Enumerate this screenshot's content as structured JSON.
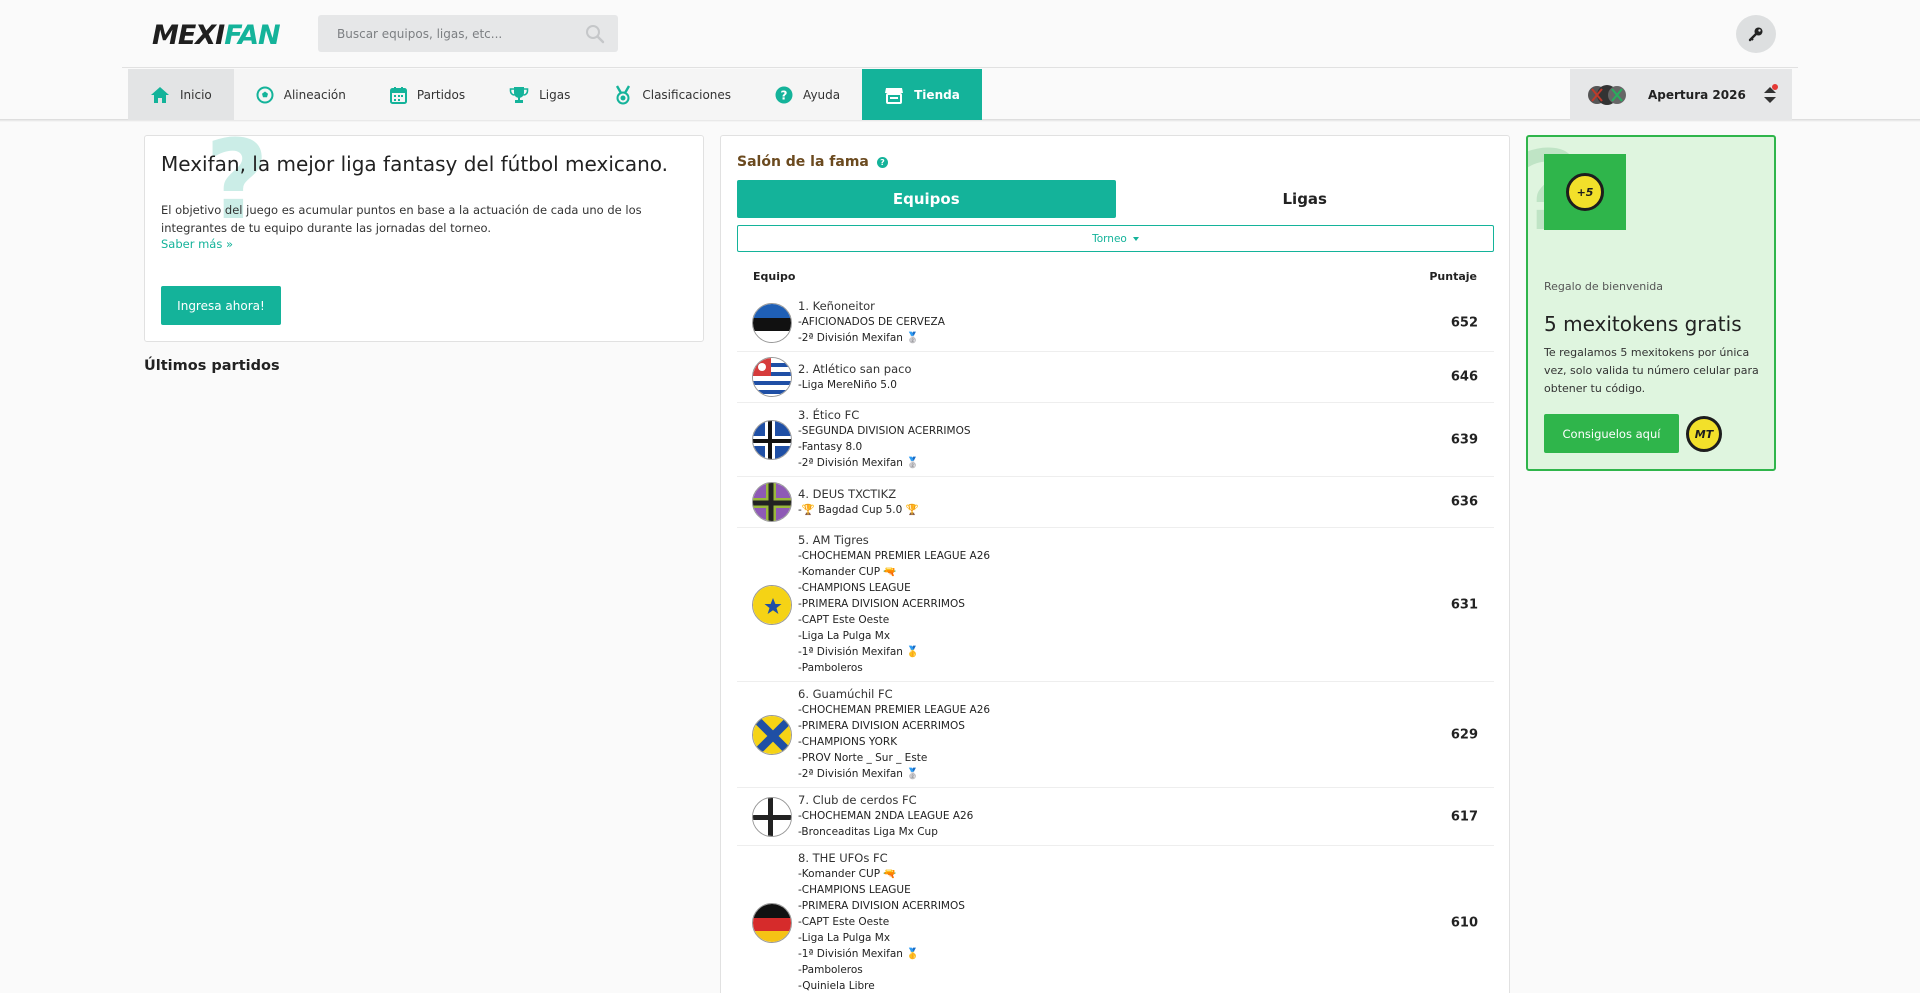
{
  "header": {
    "logo_mexi": "MEXI",
    "logo_fan": "FAN",
    "search_placeholder": "Buscar equipos, ligas, etc..."
  },
  "nav": {
    "items": [
      {
        "label": "Inicio",
        "icon": "home-icon"
      },
      {
        "label": "Alineación",
        "icon": "soccer-ball-icon"
      },
      {
        "label": "Partidos",
        "icon": "calendar-icon"
      },
      {
        "label": "Ligas",
        "icon": "trophy-icon"
      },
      {
        "label": "Clasificaciones",
        "icon": "medal-icon"
      },
      {
        "label": "Ayuda",
        "icon": "help-icon"
      },
      {
        "label": "Tienda",
        "icon": "store-icon"
      }
    ],
    "season": "Apertura 2026"
  },
  "intro": {
    "title": "Mexifan, la mejor liga fantasy del fútbol mexicano.",
    "description": "El objetivo del juego es acumular puntos en base a la actuación de cada uno de los integrantes de tu equipo durante las jornadas del torneo.",
    "more_link": "Saber más »",
    "cta": "Ingresa ahora!"
  },
  "latest_matches_title": "Últimos partidos",
  "hall_of_fame": {
    "title": "Salón de la fama",
    "tabs": [
      "Equipos",
      "Ligas"
    ],
    "filter": "Torneo",
    "col_team": "Equipo",
    "col_points": "Puntaje",
    "rows": [
      {
        "rank": "1.",
        "team": "Keñoneitor",
        "leagues": [
          "AFICIONADOS DE CERVEZA",
          "2ª División Mexifan 🥈"
        ],
        "points": "652",
        "flag": "estonia"
      },
      {
        "rank": "2.",
        "team": "Atlético san paco",
        "leagues": [
          "Liga MereNiño 5.0"
        ],
        "points": "646",
        "flag": "uruguay"
      },
      {
        "rank": "3.",
        "team": "Ético FC",
        "leagues": [
          "SEGUNDA DIVISION ACERRIMOS",
          "Fantasy 8.0",
          "2ª División Mexifan 🥈"
        ],
        "points": "639",
        "flag": "norway"
      },
      {
        "rank": "4.",
        "team": "DEUS TXCTIKZ",
        "leagues": [
          "🏆 Bagdad Cup 5.0 🏆"
        ],
        "points": "636",
        "flag": "purple"
      },
      {
        "rank": "5.",
        "team": "AM Tigres",
        "leagues": [
          "CHOCHEMAN PREMIER LEAGUE A26",
          "Komander CUP 🔫",
          "CHAMPIONS LEAGUE",
          "PRIMERA DIVISION ACERRIMOS",
          "CAPT Este Oeste",
          "Liga La Pulga Mx",
          "1ª División Mexifan 🥇",
          "Pamboleros"
        ],
        "points": "631",
        "flag": "star"
      },
      {
        "rank": "6.",
        "team": "Guamúchil FC",
        "leagues": [
          "CHOCHEMAN PREMIER LEAGUE A26",
          "PRIMERA DIVISION ACERRIMOS",
          "CHAMPIONS YORK",
          "PROV Norte _ Sur _ Este",
          "2ª División Mexifan 🥈"
        ],
        "points": "629",
        "flag": "jamaica"
      },
      {
        "rank": "7.",
        "team": "Club de cerdos FC",
        "leagues": [
          "CHOCHEMAN 2NDA LEAGUE A26",
          "Bronceaditas Liga Mx Cup"
        ],
        "points": "617",
        "flag": "cross"
      },
      {
        "rank": "8.",
        "team": "THE UFOs FC",
        "leagues": [
          "Komander CUP 🔫",
          "CHAMPIONS LEAGUE",
          "PRIMERA DIVISION ACERRIMOS",
          "CAPT Este Oeste",
          "Liga La Pulga Mx",
          "1ª División Mexifan 🥇",
          "Pamboleros",
          "Quiniela Libre"
        ],
        "points": "610",
        "flag": "germany"
      }
    ]
  },
  "promo": {
    "badge": "+5",
    "kicker": "Regalo de bienvenida",
    "title": "5 mexitokens gratis",
    "text": "Te regalamos 5 mexitokens por única vez, solo valida tu número celular para obtener tu código.",
    "button": "Consiguelos aquí",
    "coin": "MT"
  },
  "colors": {
    "accent": "#14b39a",
    "promo_green": "#2fb54b",
    "hall_title": "#6b4a1f"
  }
}
